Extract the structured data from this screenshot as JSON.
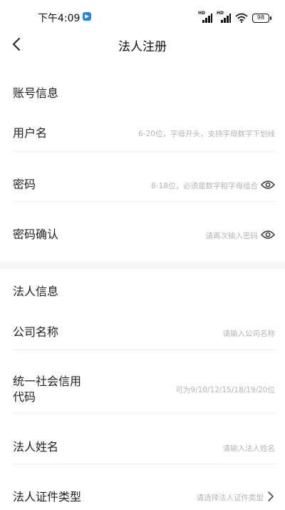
{
  "status_bar": {
    "time": "下午4:09",
    "battery": "98",
    "signal_1_label": "HD",
    "signal_2_label": "HD"
  },
  "nav": {
    "title": "法人注册"
  },
  "account_section": {
    "title": "账号信息",
    "fields": {
      "username": {
        "label": "用户名",
        "placeholder": "6-20位，字母开头，支持字母数字下划线"
      },
      "password": {
        "label": "密码",
        "placeholder": "8-18位，必须是数字和字母组合"
      },
      "password_confirm": {
        "label": "密码确认",
        "placeholder": "请再次输入密码"
      }
    }
  },
  "legal_section": {
    "title": "法人信息",
    "fields": {
      "company_name": {
        "label": "公司名称",
        "placeholder": "请输入公司名称"
      },
      "credit_code": {
        "label_line1": "统一社会信用",
        "label_line2": "代码",
        "placeholder": "可为9/10/12/15/18/19/20位"
      },
      "legal_name": {
        "label": "法人姓名",
        "placeholder": "请输入法人姓名"
      },
      "id_type": {
        "label": "法人证件类型",
        "placeholder": "请选择法人证件类型"
      }
    }
  },
  "colors": {
    "placeholder": "#b5b5b5",
    "divider": "#ececec",
    "section_gap": "#f5f6f8",
    "app_icon": "#1e88e5"
  }
}
